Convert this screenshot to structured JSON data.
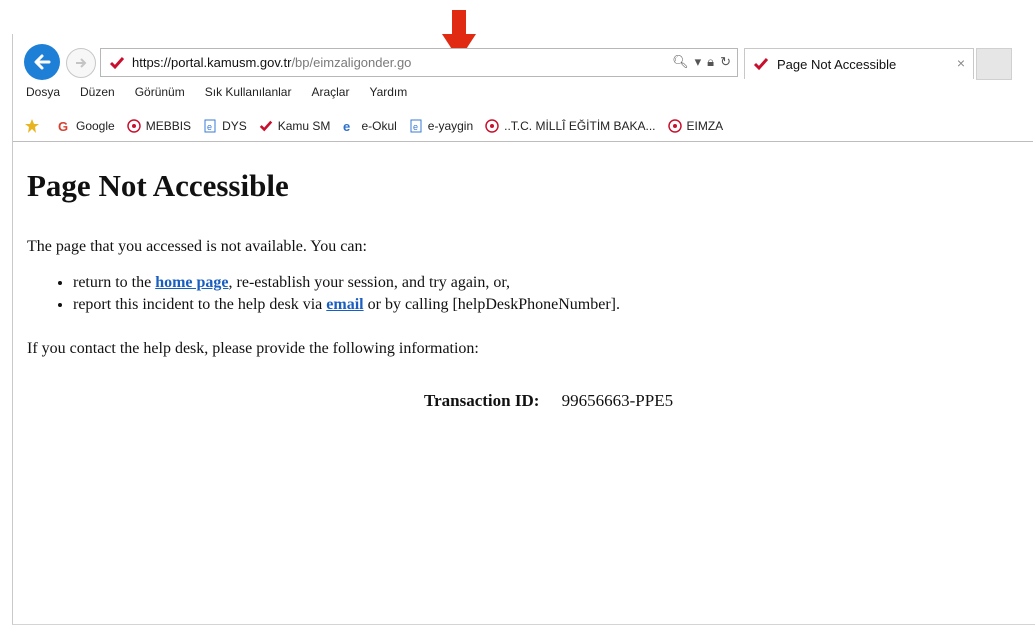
{
  "browser": {
    "url_host": "https://portal.kamusm.gov.tr",
    "url_path": "/bp/eimzaligonder.go",
    "tab_title": "Page Not Accessible",
    "menu": [
      "Dosya",
      "Düzen",
      "Görünüm",
      "Sık Kullanılanlar",
      "Araçlar",
      "Yardım"
    ],
    "favorites": [
      "Google",
      "MEBBIS",
      "DYS",
      "Kamu SM",
      "e-Okul",
      "e-yaygin",
      "..T.C. MİLLÎ EĞİTİM BAKA...",
      "EIMZA"
    ]
  },
  "page": {
    "title": "Page Not Accessible",
    "intro": "The page that you accessed is not available. You can:",
    "bullet1_pre": "return to the ",
    "bullet1_link": "home page",
    "bullet1_post": ", re-establish your session, and try again, or,",
    "bullet2_pre": "report this incident to the help desk via ",
    "bullet2_link": "email",
    "bullet2_post": " or by calling [helpDeskPhoneNumber].",
    "contact": "If you contact the help desk, please provide the following information:",
    "transaction_label": "Transaction ID:",
    "transaction_id": "99656663-PPE5"
  },
  "colors": {
    "accent": "#1e7fd6",
    "link": "#1a5ebf",
    "annotation_arrow": "#e02a12"
  }
}
